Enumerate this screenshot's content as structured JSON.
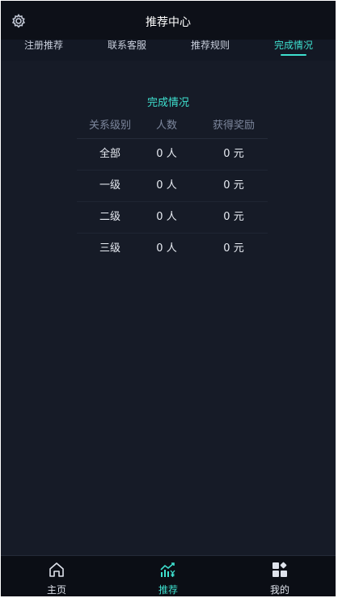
{
  "header": {
    "title": "推荐中心",
    "settings_icon": "gear-icon"
  },
  "tabs": [
    {
      "label": "注册推荐",
      "active": false
    },
    {
      "label": "联系客服",
      "active": false
    },
    {
      "label": "推荐规则",
      "active": false
    },
    {
      "label": "完成情况",
      "active": true
    }
  ],
  "completion": {
    "title": "完成情况",
    "headers": [
      "关系级别",
      "人数",
      "获得奖励"
    ],
    "rows": [
      {
        "level": "全部",
        "count": "0 人",
        "reward": "0 元"
      },
      {
        "level": "一级",
        "count": "0 人",
        "reward": "0 元"
      },
      {
        "level": "二级",
        "count": "0 人",
        "reward": "0 元"
      },
      {
        "level": "三级",
        "count": "0 人",
        "reward": "0 元"
      }
    ]
  },
  "bottom_nav": [
    {
      "label": "主页",
      "icon": "home-icon",
      "active": false
    },
    {
      "label": "推荐",
      "icon": "referral-chart-icon",
      "active": true
    },
    {
      "label": "我的",
      "icon": "apps-grid-icon",
      "active": false
    }
  ],
  "colors": {
    "accent": "#3ee0cf",
    "background": "#161b27",
    "header_bg": "#0d1018"
  }
}
